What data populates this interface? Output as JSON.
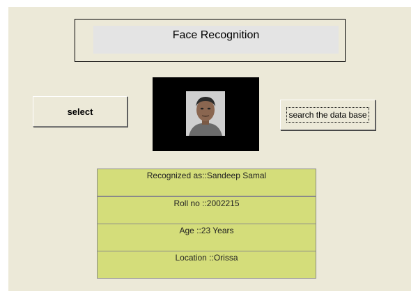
{
  "header": {
    "title": "Face Recognition"
  },
  "buttons": {
    "select_label": "select",
    "search_label": "search the data base"
  },
  "result": {
    "recognized": "Recognized as::Sandeep Samal",
    "roll": "Roll no ::2002215",
    "age": "Age ::23 Years",
    "location": "Location ::Orissa"
  },
  "colors": {
    "background": "#ece9d8",
    "info_panel": "#d4dd7a",
    "image_frame": "#000000",
    "title_fill": "#e4e4e4"
  },
  "icons": {
    "photo": "face-photo"
  }
}
